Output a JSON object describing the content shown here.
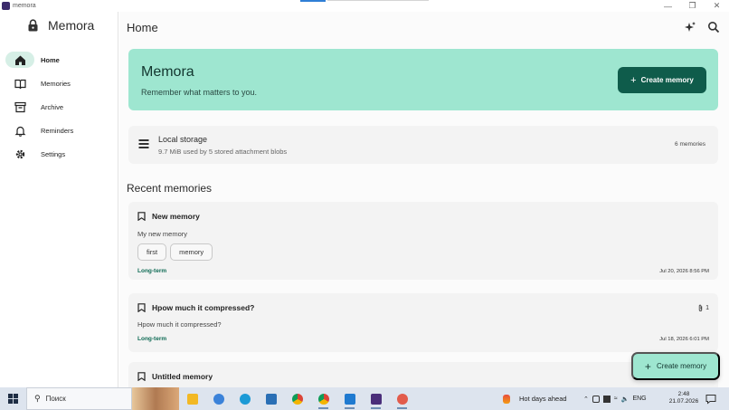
{
  "window": {
    "title": "memora"
  },
  "sidebar": {
    "brand": "Memora",
    "items": [
      {
        "label": "Home",
        "icon": "home-icon",
        "active": true
      },
      {
        "label": "Memories",
        "icon": "book-icon",
        "active": false
      },
      {
        "label": "Archive",
        "icon": "archive-icon",
        "active": false
      },
      {
        "label": "Reminders",
        "icon": "bell-icon",
        "active": false
      },
      {
        "label": "Settings",
        "icon": "gear-icon",
        "active": false
      }
    ]
  },
  "header": {
    "title": "Home"
  },
  "hero": {
    "title": "Memora",
    "subtitle": "Remember what matters to you.",
    "button_label": "Create memory"
  },
  "storage": {
    "title": "Local storage",
    "subtitle": "9.7 MiB used by 5 stored attachment blobs",
    "count": "6 memories"
  },
  "recent": {
    "title": "Recent memories",
    "cards": [
      {
        "title": "New memory",
        "body": "My new memory",
        "tags": [
          "first",
          "memory"
        ],
        "term": "Long-term",
        "date": "Jul 20, 2026 8:56 PM",
        "attachments": ""
      },
      {
        "title": "Hpow much it compressed?",
        "body": "Hpow much it compressed?",
        "tags": [],
        "term": "Long-term",
        "date": "Jul 18, 2026 6:01 PM",
        "attachments": "1"
      },
      {
        "title": "Untitled memory",
        "body": "",
        "tags": [],
        "term": "",
        "date": "",
        "attachments": ""
      }
    ]
  },
  "fab": {
    "label": "Create memory"
  },
  "taskbar": {
    "search_placeholder": "Поиск",
    "weather": "Hot days ahead",
    "language": "ENG",
    "time": "2:48",
    "date": "21.07.2026"
  },
  "colors": {
    "accent": "#0f5c4b",
    "hero_bg": "#9ee6d0",
    "term": "#0f6b55"
  }
}
